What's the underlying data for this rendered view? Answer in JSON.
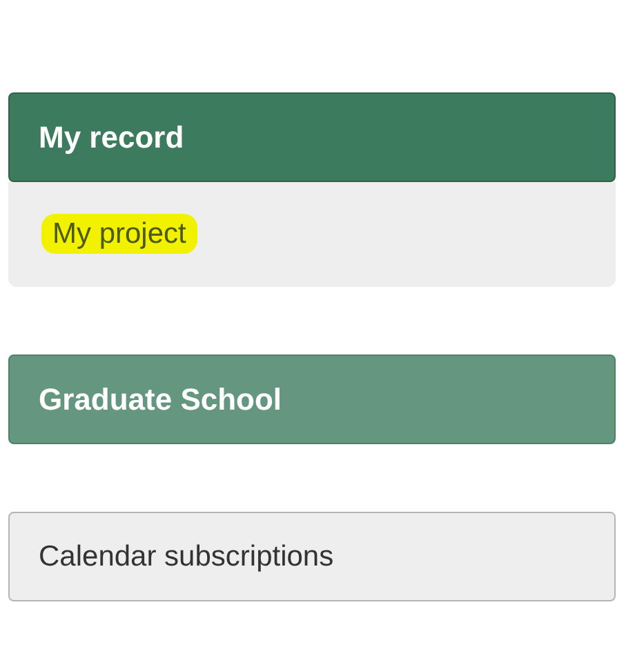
{
  "sections": [
    {
      "kind": "panel",
      "title": "My record",
      "expanded": true,
      "items": [
        {
          "label": "My project",
          "highlighted": true
        }
      ]
    },
    {
      "kind": "panel",
      "title": "Graduate School",
      "expanded": false
    },
    {
      "kind": "button",
      "title": "Calendar subscriptions"
    }
  ]
}
